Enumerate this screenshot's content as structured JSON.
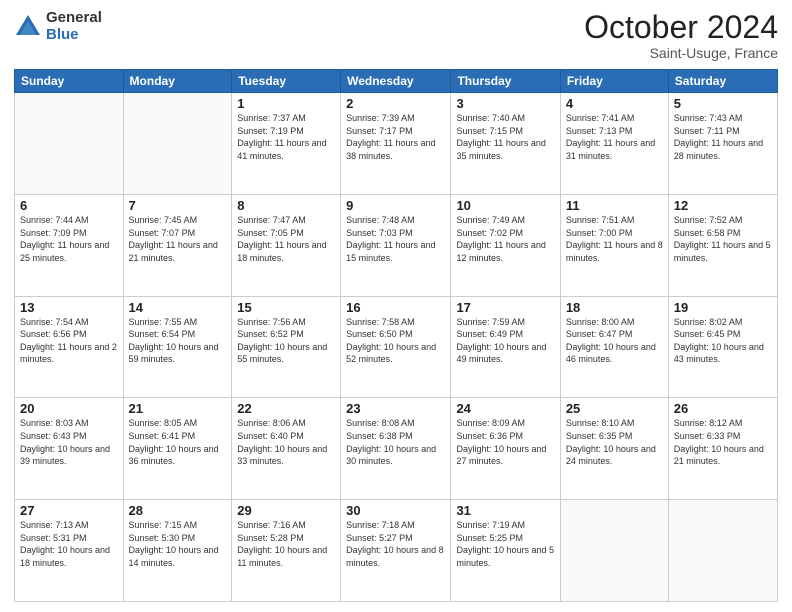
{
  "header": {
    "logo_general": "General",
    "logo_blue": "Blue",
    "month_title": "October 2024",
    "subtitle": "Saint-Usuge, France"
  },
  "weekdays": [
    "Sunday",
    "Monday",
    "Tuesday",
    "Wednesday",
    "Thursday",
    "Friday",
    "Saturday"
  ],
  "weeks": [
    [
      {
        "day": "",
        "info": ""
      },
      {
        "day": "",
        "info": ""
      },
      {
        "day": "1",
        "info": "Sunrise: 7:37 AM\nSunset: 7:19 PM\nDaylight: 11 hours and 41 minutes."
      },
      {
        "day": "2",
        "info": "Sunrise: 7:39 AM\nSunset: 7:17 PM\nDaylight: 11 hours and 38 minutes."
      },
      {
        "day": "3",
        "info": "Sunrise: 7:40 AM\nSunset: 7:15 PM\nDaylight: 11 hours and 35 minutes."
      },
      {
        "day": "4",
        "info": "Sunrise: 7:41 AM\nSunset: 7:13 PM\nDaylight: 11 hours and 31 minutes."
      },
      {
        "day": "5",
        "info": "Sunrise: 7:43 AM\nSunset: 7:11 PM\nDaylight: 11 hours and 28 minutes."
      }
    ],
    [
      {
        "day": "6",
        "info": "Sunrise: 7:44 AM\nSunset: 7:09 PM\nDaylight: 11 hours and 25 minutes."
      },
      {
        "day": "7",
        "info": "Sunrise: 7:45 AM\nSunset: 7:07 PM\nDaylight: 11 hours and 21 minutes."
      },
      {
        "day": "8",
        "info": "Sunrise: 7:47 AM\nSunset: 7:05 PM\nDaylight: 11 hours and 18 minutes."
      },
      {
        "day": "9",
        "info": "Sunrise: 7:48 AM\nSunset: 7:03 PM\nDaylight: 11 hours and 15 minutes."
      },
      {
        "day": "10",
        "info": "Sunrise: 7:49 AM\nSunset: 7:02 PM\nDaylight: 11 hours and 12 minutes."
      },
      {
        "day": "11",
        "info": "Sunrise: 7:51 AM\nSunset: 7:00 PM\nDaylight: 11 hours and 8 minutes."
      },
      {
        "day": "12",
        "info": "Sunrise: 7:52 AM\nSunset: 6:58 PM\nDaylight: 11 hours and 5 minutes."
      }
    ],
    [
      {
        "day": "13",
        "info": "Sunrise: 7:54 AM\nSunset: 6:56 PM\nDaylight: 11 hours and 2 minutes."
      },
      {
        "day": "14",
        "info": "Sunrise: 7:55 AM\nSunset: 6:54 PM\nDaylight: 10 hours and 59 minutes."
      },
      {
        "day": "15",
        "info": "Sunrise: 7:56 AM\nSunset: 6:52 PM\nDaylight: 10 hours and 55 minutes."
      },
      {
        "day": "16",
        "info": "Sunrise: 7:58 AM\nSunset: 6:50 PM\nDaylight: 10 hours and 52 minutes."
      },
      {
        "day": "17",
        "info": "Sunrise: 7:59 AM\nSunset: 6:49 PM\nDaylight: 10 hours and 49 minutes."
      },
      {
        "day": "18",
        "info": "Sunrise: 8:00 AM\nSunset: 6:47 PM\nDaylight: 10 hours and 46 minutes."
      },
      {
        "day": "19",
        "info": "Sunrise: 8:02 AM\nSunset: 6:45 PM\nDaylight: 10 hours and 43 minutes."
      }
    ],
    [
      {
        "day": "20",
        "info": "Sunrise: 8:03 AM\nSunset: 6:43 PM\nDaylight: 10 hours and 39 minutes."
      },
      {
        "day": "21",
        "info": "Sunrise: 8:05 AM\nSunset: 6:41 PM\nDaylight: 10 hours and 36 minutes."
      },
      {
        "day": "22",
        "info": "Sunrise: 8:06 AM\nSunset: 6:40 PM\nDaylight: 10 hours and 33 minutes."
      },
      {
        "day": "23",
        "info": "Sunrise: 8:08 AM\nSunset: 6:38 PM\nDaylight: 10 hours and 30 minutes."
      },
      {
        "day": "24",
        "info": "Sunrise: 8:09 AM\nSunset: 6:36 PM\nDaylight: 10 hours and 27 minutes."
      },
      {
        "day": "25",
        "info": "Sunrise: 8:10 AM\nSunset: 6:35 PM\nDaylight: 10 hours and 24 minutes."
      },
      {
        "day": "26",
        "info": "Sunrise: 8:12 AM\nSunset: 6:33 PM\nDaylight: 10 hours and 21 minutes."
      }
    ],
    [
      {
        "day": "27",
        "info": "Sunrise: 7:13 AM\nSunset: 5:31 PM\nDaylight: 10 hours and 18 minutes."
      },
      {
        "day": "28",
        "info": "Sunrise: 7:15 AM\nSunset: 5:30 PM\nDaylight: 10 hours and 14 minutes."
      },
      {
        "day": "29",
        "info": "Sunrise: 7:16 AM\nSunset: 5:28 PM\nDaylight: 10 hours and 11 minutes."
      },
      {
        "day": "30",
        "info": "Sunrise: 7:18 AM\nSunset: 5:27 PM\nDaylight: 10 hours and 8 minutes."
      },
      {
        "day": "31",
        "info": "Sunrise: 7:19 AM\nSunset: 5:25 PM\nDaylight: 10 hours and 5 minutes."
      },
      {
        "day": "",
        "info": ""
      },
      {
        "day": "",
        "info": ""
      }
    ]
  ]
}
